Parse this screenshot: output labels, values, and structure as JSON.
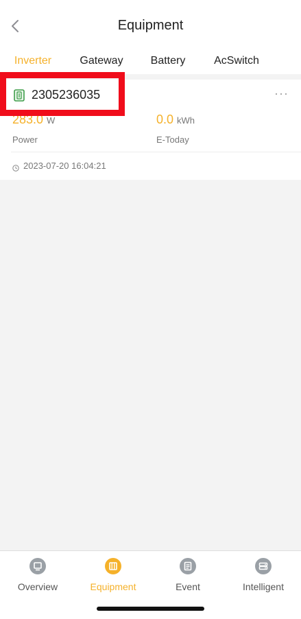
{
  "header": {
    "title": "Equipment",
    "back_icon": "chevron-left-icon"
  },
  "tabs": [
    {
      "label": "Inverter",
      "active": true
    },
    {
      "label": "Gateway",
      "active": false
    },
    {
      "label": "Battery",
      "active": false
    },
    {
      "label": "AcSwitch",
      "active": false
    }
  ],
  "device": {
    "id": "2305236035",
    "more": "···",
    "power": {
      "value": "283.0",
      "unit": "W",
      "label": "Power"
    },
    "energy": {
      "value": "0.0",
      "unit": "kWh",
      "label": "E-Today"
    },
    "timestamp": "2023-07-20 16:04:21"
  },
  "bottom_nav": [
    {
      "label": "Overview",
      "icon": "overview-icon",
      "active": false
    },
    {
      "label": "Equipment",
      "icon": "equipment-icon",
      "active": true
    },
    {
      "label": "Event",
      "icon": "event-icon",
      "active": false
    },
    {
      "label": "Intelligent",
      "icon": "intelligent-icon",
      "active": false
    }
  ],
  "colors": {
    "accent": "#f5b12a",
    "highlight": "#f00d1b",
    "icon_inactive": "#9aa0a6"
  }
}
